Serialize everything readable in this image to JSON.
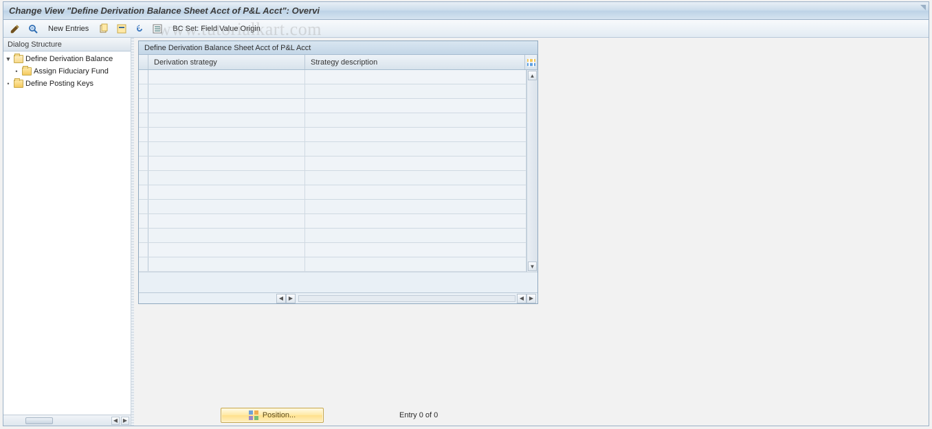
{
  "title": "Change View \"Define Derivation Balance Sheet Acct of P&L Acct\": Overvi",
  "toolbar": {
    "new_entries_label": "New Entries",
    "bc_set_label": "BC Set: Field Value Origin"
  },
  "sidebar": {
    "header": "Dialog Structure",
    "items": [
      {
        "label": "Define Derivation Balance",
        "level": 0,
        "expanded": true,
        "open": true
      },
      {
        "label": "Assign Fiduciary Fund",
        "level": 1,
        "expanded": false,
        "open": false
      },
      {
        "label": "Define Posting Keys",
        "level": 0,
        "expanded": false,
        "open": false
      }
    ]
  },
  "table": {
    "title": "Define Derivation Balance Sheet Acct of P&L Acct",
    "columns": {
      "c1": "Derivation strategy",
      "c2": "Strategy description"
    },
    "row_count": 14
  },
  "footer": {
    "position_label": "Position...",
    "entry_text": "Entry 0 of 0"
  },
  "watermark": "www.tutorialkart.com"
}
